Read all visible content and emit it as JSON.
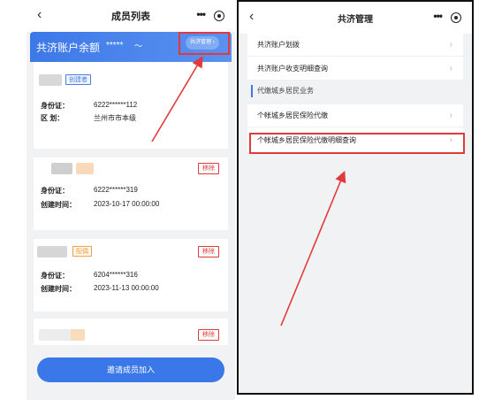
{
  "left": {
    "nav": {
      "title": "成员列表",
      "back": "‹",
      "more": "•••"
    },
    "banner": {
      "title": "共济账户余额",
      "mask": "*****",
      "eye": "〜",
      "manage": "共济管理 ›"
    },
    "cards": [
      {
        "tag": "创建者",
        "id_label": "身份证：",
        "id_value": "6222******112",
        "area_label": "区 划：",
        "area_value": "兰州市市本级"
      },
      {
        "remove": "移除",
        "id_label": "身份证：",
        "id_value": "6222******319",
        "time_label": "创建时间：",
        "time_value": "2023-10-17 00:00:00"
      },
      {
        "tag": "配偶",
        "remove": "移除",
        "id_label": "身份证：",
        "id_value": "6204******316",
        "time_label": "创建时间：",
        "time_value": "2023-11-13 00:00:00"
      },
      {
        "remove": "移除"
      }
    ],
    "invite": "邀请成员加入"
  },
  "right": {
    "nav": {
      "title": "共济管理",
      "back": "‹",
      "more": "•••"
    },
    "items_group1": [
      "共济账户划拨",
      "共济账户收支明细查询"
    ],
    "section": "代缴城乡居民业务",
    "items_group2": [
      "个帐城乡居民保险代缴",
      "个帐城乡居民保险代缴明细查询"
    ],
    "chevron": "›"
  },
  "colors": {
    "accent": "#3a78ea",
    "highlight": "#e23a3a",
    "remove": "#e03c3c",
    "tag_orange": "#f0a24a"
  }
}
